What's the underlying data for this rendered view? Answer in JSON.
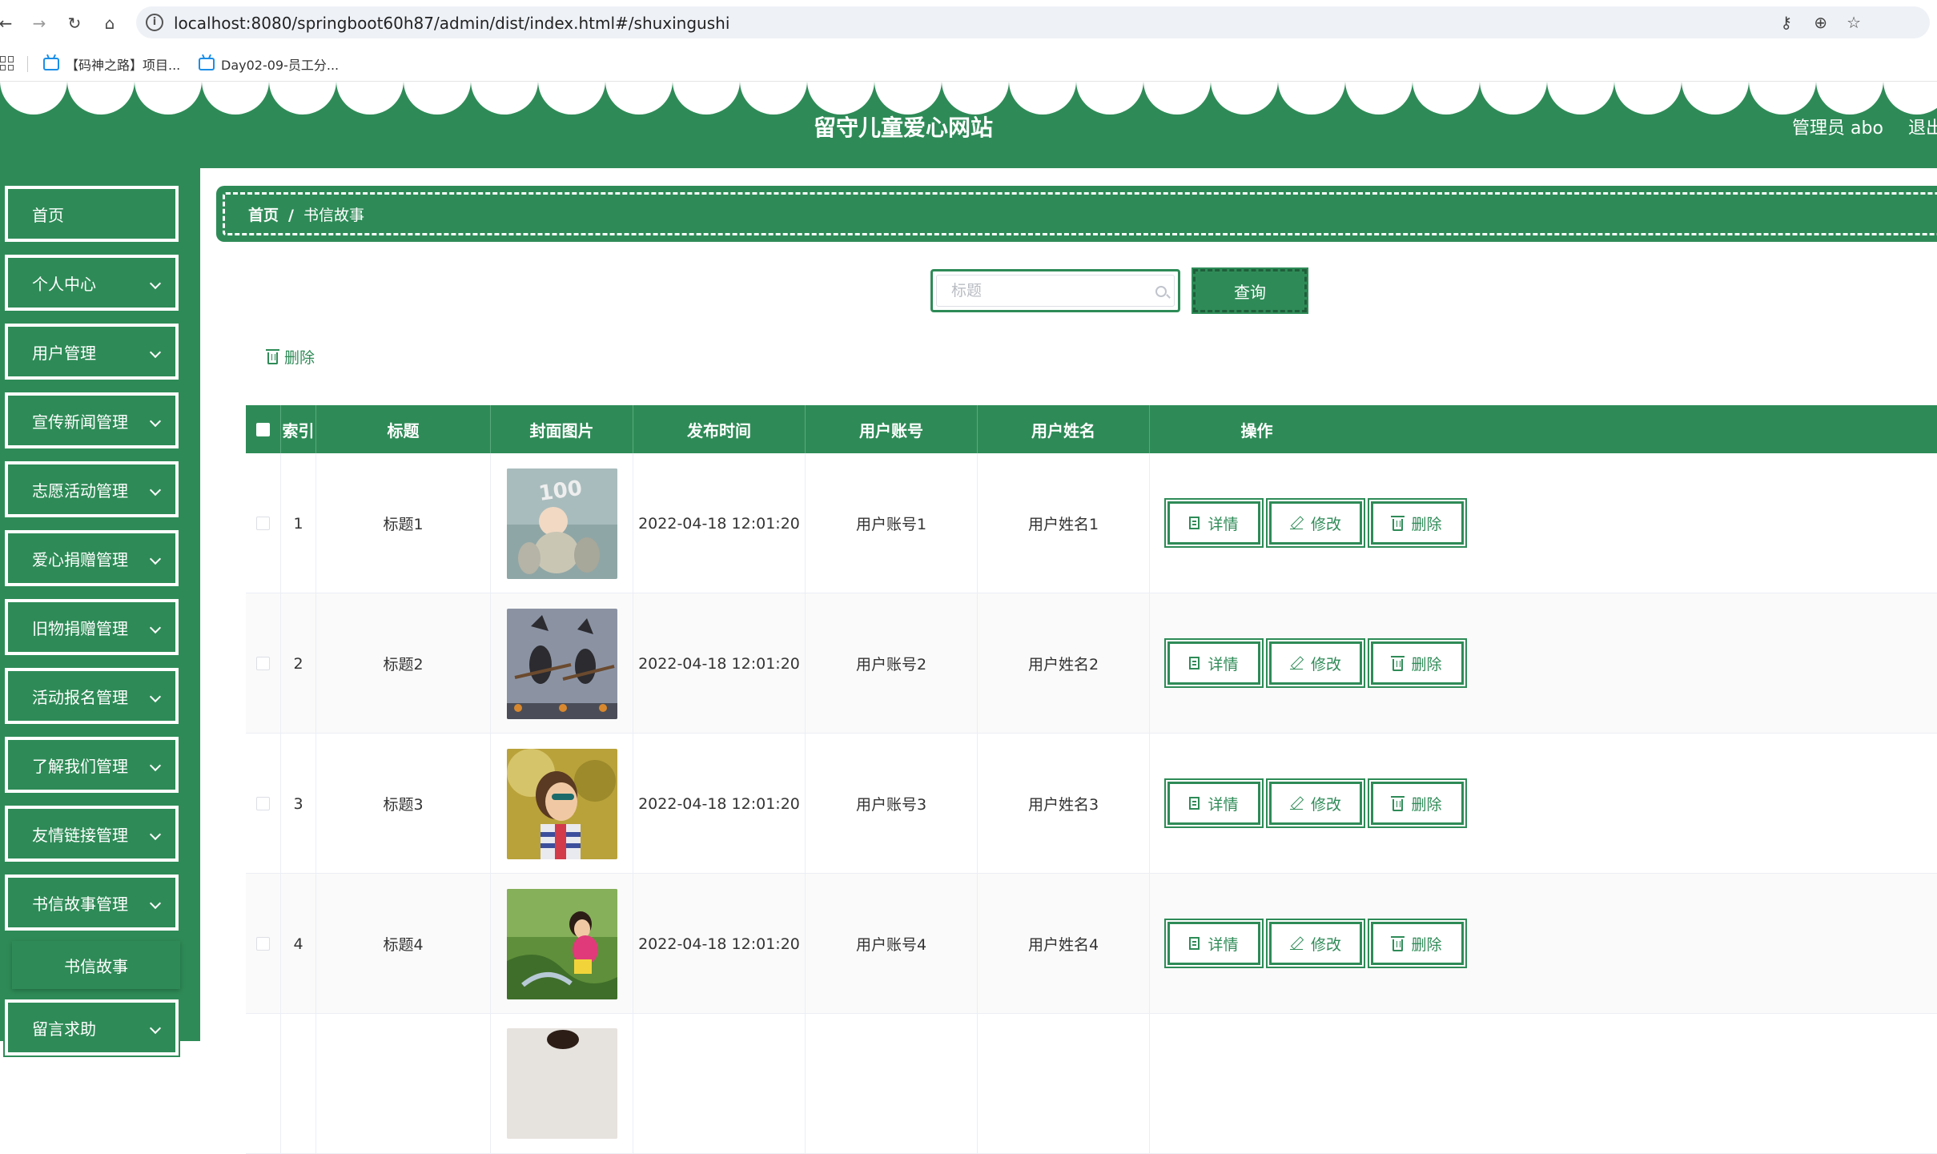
{
  "browser": {
    "url": "localhost:8080/springboot60h87/admin/dist/index.html#/shuxingushi",
    "bookmarks": [
      {
        "label": "【码神之路】项目..."
      },
      {
        "label": "Day02-09-员工分..."
      }
    ]
  },
  "header": {
    "title": "留守儿童爱心网站",
    "user": "管理员 abo",
    "logout": "退出"
  },
  "sidebar": {
    "items": [
      {
        "label": "首页",
        "expandable": false
      },
      {
        "label": "个人中心",
        "expandable": true
      },
      {
        "label": "用户管理",
        "expandable": true
      },
      {
        "label": "宣传新闻管理",
        "expandable": true
      },
      {
        "label": "志愿活动管理",
        "expandable": true
      },
      {
        "label": "爱心捐赠管理",
        "expandable": true
      },
      {
        "label": "旧物捐赠管理",
        "expandable": true
      },
      {
        "label": "活动报名管理",
        "expandable": true
      },
      {
        "label": "了解我们管理",
        "expandable": true
      },
      {
        "label": "友情链接管理",
        "expandable": true
      },
      {
        "label": "书信故事管理",
        "expandable": true
      },
      {
        "label": "留言求助",
        "expandable": true
      }
    ],
    "active_submenu": "书信故事"
  },
  "breadcrumb": {
    "home": "首页",
    "separator": "/",
    "current": "书信故事"
  },
  "search": {
    "placeholder": "标题",
    "value": "",
    "button_label": "查询"
  },
  "actions": {
    "batch_delete_label": "删除"
  },
  "table": {
    "columns": [
      "索引",
      "标题",
      "封面图片",
      "发布时间",
      "用户账号",
      "用户姓名",
      "操作"
    ],
    "rows": [
      {
        "index": "1",
        "title": "标题1",
        "cover": "baby-100-days-photo",
        "time": "2022-04-18 12:01:20",
        "account": "用户账号1",
        "name": "用户姓名1"
      },
      {
        "index": "2",
        "title": "标题2",
        "cover": "witches-on-broom-photo",
        "time": "2022-04-18 12:01:20",
        "account": "用户账号2",
        "name": "用户姓名2"
      },
      {
        "index": "3",
        "title": "标题3",
        "cover": "girl-sunglasses-photo",
        "time": "2022-04-18 12:01:20",
        "account": "用户账号3",
        "name": "用户姓名3"
      },
      {
        "index": "4",
        "title": "标题4",
        "cover": "girl-in-grass-photo",
        "time": "2022-04-18 12:01:20",
        "account": "用户账号4",
        "name": "用户姓名4"
      }
    ],
    "row_actions": {
      "detail": "详情",
      "edit": "修改",
      "delete": "删除"
    }
  },
  "colors": {
    "primary": "#2e8b57",
    "white": "#ffffff"
  }
}
